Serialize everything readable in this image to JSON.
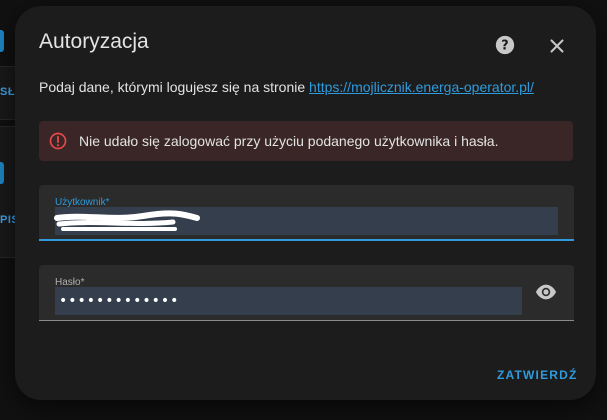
{
  "background": {
    "nav_text_1": "SŁ",
    "nav_text_2": "PIS"
  },
  "dialog": {
    "title": "Autoryzacja",
    "intro_text": "Podaj dane, którymi logujesz się na stronie ",
    "intro_link": "https://mojlicznik.energa-operator.pl/",
    "error_message": "Nie udało się zalogować przy użyciu podanego użytkownika i hasła.",
    "username": {
      "label": "Użytkownik*",
      "value": ""
    },
    "password": {
      "label": "Hasło*",
      "value": "•••••••••••••"
    },
    "submit_label": "ZATWIERDŹ",
    "icons": {
      "help": "help-icon",
      "close": "close-icon",
      "error": "alert-circle-icon",
      "show_password": "eye-icon"
    }
  },
  "colors": {
    "accent": "#2f9bdc",
    "error_icon": "#e5484d",
    "error_bg": "#3a2626",
    "dialog_bg": "#1c1c1c",
    "input_bg": "#343e4d"
  }
}
